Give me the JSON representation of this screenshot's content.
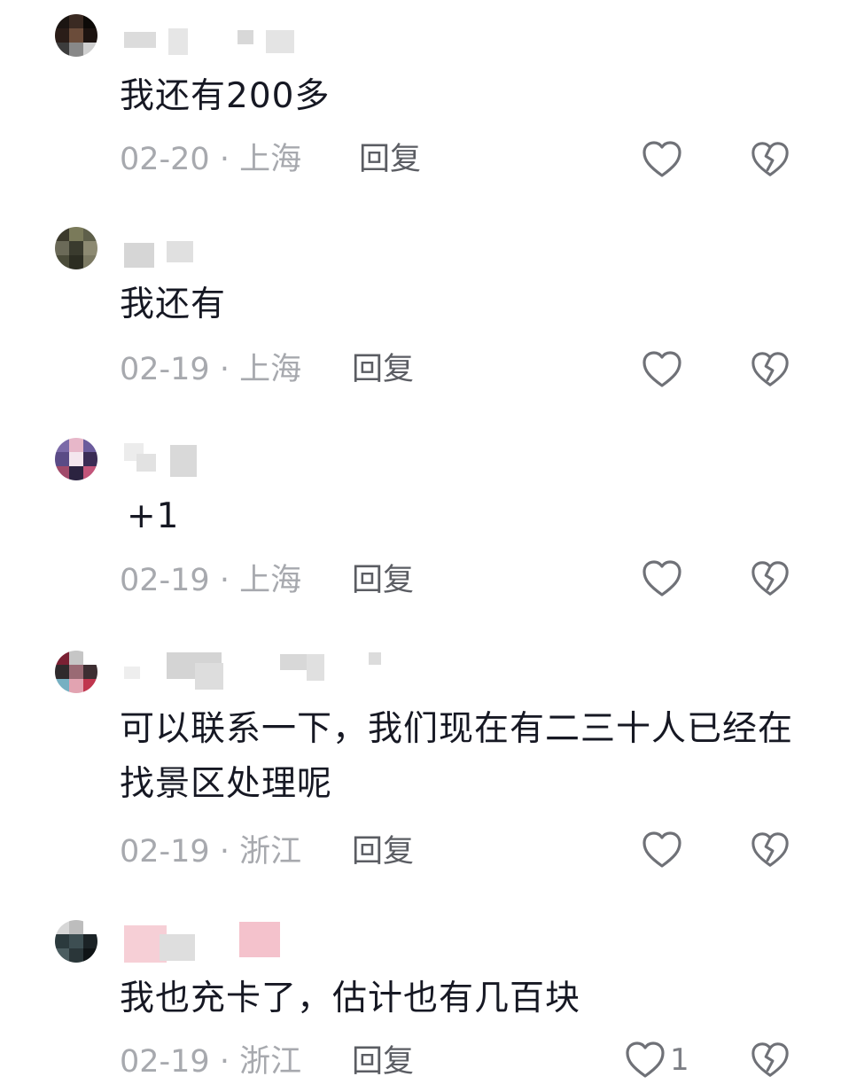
{
  "comments": [
    {
      "text": "我还有200多",
      "date": "02-20",
      "sep": " · ",
      "location": "上海",
      "reply_label": "回复",
      "like_count": "",
      "avatar_colors": [
        "#1b1512",
        "#3a2a22",
        "#0d0a08",
        "#2a1d18",
        "#6b4c3a",
        "#1d1411",
        "#3c3c3c",
        "#888888",
        "#cfcfcf"
      ]
    },
    {
      "text": "我还有",
      "date": "02-19",
      "sep": " · ",
      "location": "上海",
      "reply_label": "回复",
      "like_count": "",
      "avatar_colors": [
        "#3c3a2c",
        "#7a7a5a",
        "#5e5f4a",
        "#6b6a58",
        "#3a3b2e",
        "#8d8a72",
        "#4b4c3a",
        "#2c2d22",
        "#7c7a63"
      ]
    },
    {
      "text": "+1",
      "date": "02-19",
      "sep": " · ",
      "location": "上海",
      "reply_label": "回复",
      "like_count": "",
      "avatar_colors": [
        "#7b6aa8",
        "#e7b7c9",
        "#6b5b9c",
        "#5a4b86",
        "#f4e6ee",
        "#3b2c55",
        "#a04a6a",
        "#2b2340",
        "#c2557a"
      ]
    },
    {
      "text": "可以联系一下，我们现在有二三十人已经在找景区处理呢",
      "date": "02-19",
      "sep": " · ",
      "location": "浙江",
      "reply_label": "回复",
      "like_count": "",
      "avatar_colors": [
        "#7a2033",
        "#c6c6c6",
        "#ffffff",
        "#2f2a2c",
        "#9a6a74",
        "#3d2e32",
        "#76b0c2",
        "#e2a3b1",
        "#c0364e"
      ]
    },
    {
      "text": "我也充卡了，估计也有几百块",
      "date": "02-19",
      "sep": " · ",
      "location": "浙江",
      "reply_label": "回复",
      "like_count": "1",
      "avatar_colors": [
        "#d7d7d7",
        "#bdbdbd",
        "#ffffff",
        "#2b3a3d",
        "#3d4e52",
        "#1b2326",
        "#4b5d60",
        "#2a3639",
        "#0f1416"
      ]
    }
  ],
  "icons": {
    "like": "heart-outline-icon",
    "dislike": "broken-heart-icon"
  },
  "colors": {
    "text": "#161823",
    "meta": "#a7a9ae",
    "reply": "#5b5d63",
    "icon": "#6f7177"
  }
}
